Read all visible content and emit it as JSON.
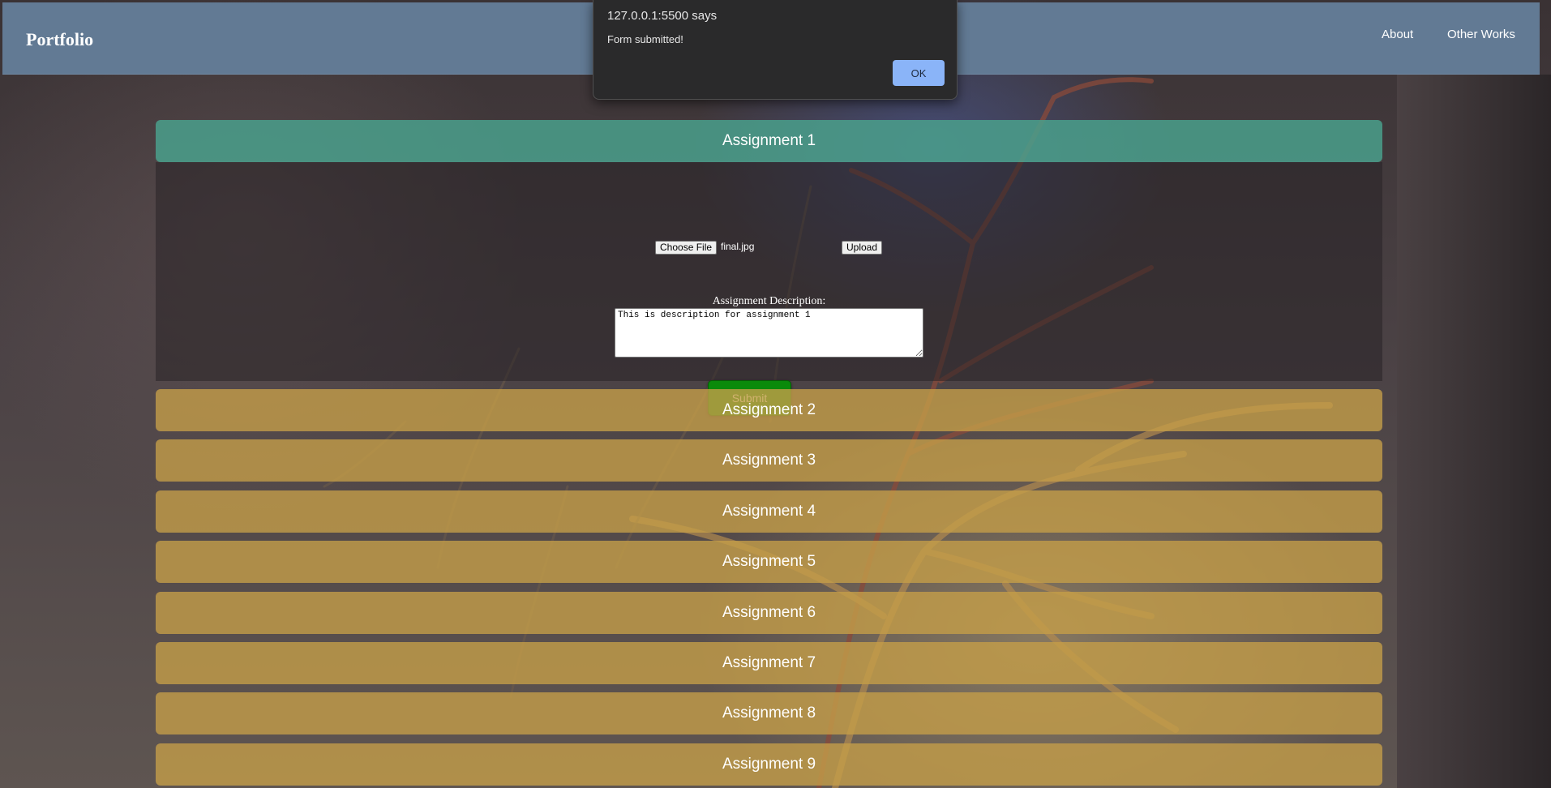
{
  "navbar": {
    "brand": "Portfolio",
    "links": [
      "About",
      "Other Works"
    ]
  },
  "assignments": [
    {
      "title": "Assignment 1",
      "expanded": true
    },
    {
      "title": "Assignment 2",
      "expanded": false
    },
    {
      "title": "Assignment 3",
      "expanded": false
    },
    {
      "title": "Assignment 4",
      "expanded": false
    },
    {
      "title": "Assignment 5",
      "expanded": false
    },
    {
      "title": "Assignment 6",
      "expanded": false
    },
    {
      "title": "Assignment 7",
      "expanded": false
    },
    {
      "title": "Assignment 8",
      "expanded": false
    },
    {
      "title": "Assignment 9",
      "expanded": false
    }
  ],
  "form": {
    "file_button": "Choose File",
    "file_name": "final.jpg",
    "upload_button": "Upload",
    "description_label": "Assignment Description:",
    "description_value": "This is description for assignment 1",
    "submit_button": "Submit"
  },
  "dialog": {
    "title": "127.0.0.1:5500 says",
    "message": "Form submitted!",
    "ok_button": "OK"
  },
  "colors": {
    "navbar": "#627a94",
    "open_header": "#4aa08c",
    "closed_header": "#c49e48",
    "submit": "#0a8a0a",
    "dialog_ok": "#8ab4f8"
  }
}
